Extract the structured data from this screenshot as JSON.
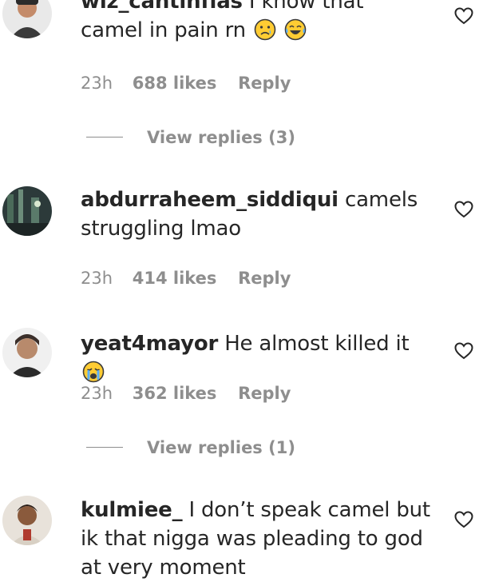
{
  "comments": [
    {
      "username": "wiz_cantinflas",
      "text": "I know that camel in pain rn",
      "time": "23h",
      "likes": "688 likes",
      "reply": "Reply",
      "emojis": [
        "sad-face-emoji",
        "tears-of-joy-emoji"
      ],
      "view_replies": "View replies (3)"
    },
    {
      "username": "abdurraheem_siddiqui",
      "text": "camels struggling lmao",
      "time": "23h",
      "likes": "414 likes",
      "reply": "Reply"
    },
    {
      "username": "yeat4mayor",
      "text": "He almost killed it",
      "time": "23h",
      "likes": "362 likes",
      "reply": "Reply",
      "emojis": [
        "loudly-crying-emoji"
      ],
      "view_replies": "View replies (1)"
    },
    {
      "username": "kulmiee_",
      "text": "I don’t speak camel but ik that nigga was pleading to god at very moment"
    }
  ],
  "colors": {
    "text": "#262626",
    "muted": "#8e8e8e",
    "background": "#ffffff"
  },
  "icons": {
    "like": "heart-outline-icon"
  }
}
